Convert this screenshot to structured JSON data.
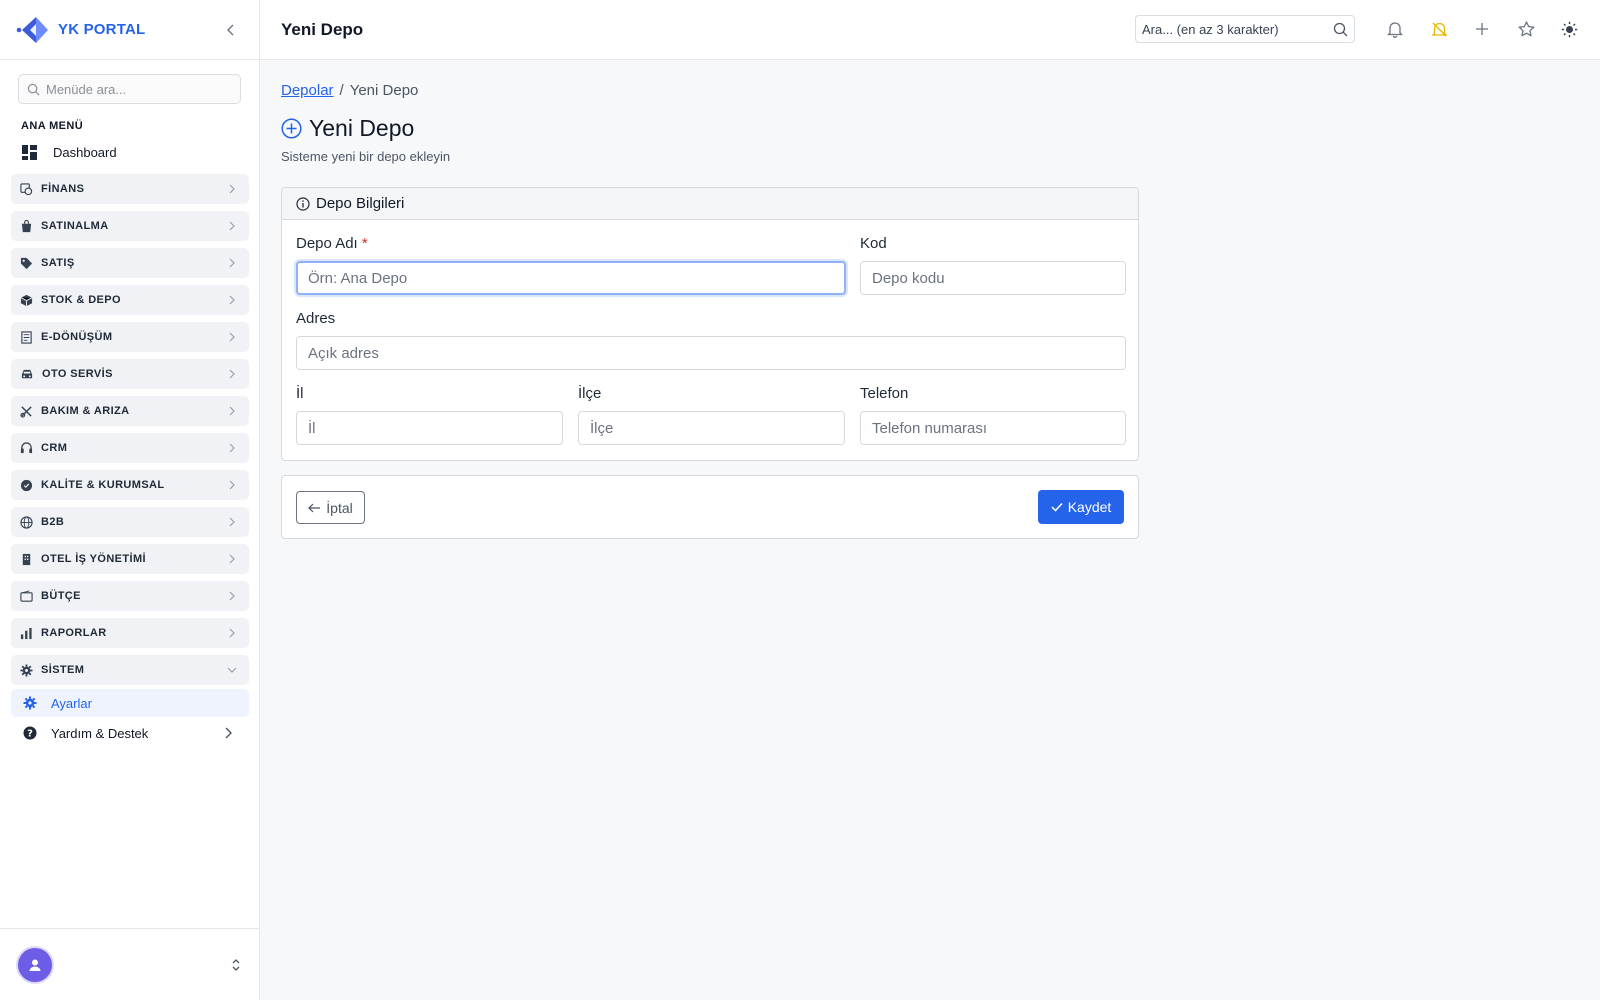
{
  "brand": {
    "name": "YK PORTAL"
  },
  "sidebar": {
    "search_placeholder": "Menüde ara...",
    "section_title": "ANA MENÜ",
    "dashboard_label": "Dashboard",
    "groups": [
      {
        "label": "FİNANS",
        "icon": "finance-icon"
      },
      {
        "label": "SATINALMA",
        "icon": "shopping-bag-icon"
      },
      {
        "label": "SATIŞ",
        "icon": "tag-icon"
      },
      {
        "label": "STOK & DEPO",
        "icon": "box-icon"
      },
      {
        "label": "E-DÖNÜŞÜM",
        "icon": "document-icon"
      },
      {
        "label": "OTO SERVİS",
        "icon": "car-icon"
      },
      {
        "label": "BAKIM & ARIZA",
        "icon": "tools-icon"
      },
      {
        "label": "CRM",
        "icon": "headset-icon"
      },
      {
        "label": "KALİTE & KURUMSAL",
        "icon": "badge-icon"
      },
      {
        "label": "B2B",
        "icon": "globe-icon"
      },
      {
        "label": "OTEL İŞ YÖNETİMİ",
        "icon": "building-icon"
      },
      {
        "label": "BÜTÇE",
        "icon": "wallet-icon"
      },
      {
        "label": "RAPORLAR",
        "icon": "bar-chart-icon"
      },
      {
        "label": "SİSTEM",
        "icon": "gear-icon",
        "expanded": true
      }
    ],
    "system_items": [
      {
        "label": "Ayarlar",
        "icon": "gear-icon",
        "active": true
      }
    ],
    "help_label": "Yardım & Destek"
  },
  "header": {
    "title": "Yeni Depo",
    "search_placeholder": "Ara... (en az 3 karakter)"
  },
  "breadcrumb": {
    "parent": "Depolar",
    "current": "Yeni Depo"
  },
  "page": {
    "title": "Yeni Depo",
    "subtitle": "Sisteme yeni bir depo ekleyin"
  },
  "form": {
    "card_title": "Depo Bilgileri",
    "name": {
      "label": "Depo Adı",
      "required_mark": "*",
      "placeholder": "Örn: Ana Depo",
      "value": ""
    },
    "code": {
      "label": "Kod",
      "placeholder": "Depo kodu",
      "value": ""
    },
    "address": {
      "label": "Adres",
      "placeholder": "Açık adres",
      "value": ""
    },
    "city": {
      "label": "İl",
      "placeholder": "İl",
      "value": ""
    },
    "district": {
      "label": "İlçe",
      "placeholder": "İlçe",
      "value": ""
    },
    "phone": {
      "label": "Telefon",
      "placeholder": "Telefon numarası",
      "value": ""
    }
  },
  "actions": {
    "cancel_label": "İptal",
    "save_label": "Kaydet"
  },
  "colors": {
    "accent": "#2563eb",
    "required": "#dc2626",
    "notification_accent": "#e5b800",
    "avatar": "#6d5ce6"
  }
}
